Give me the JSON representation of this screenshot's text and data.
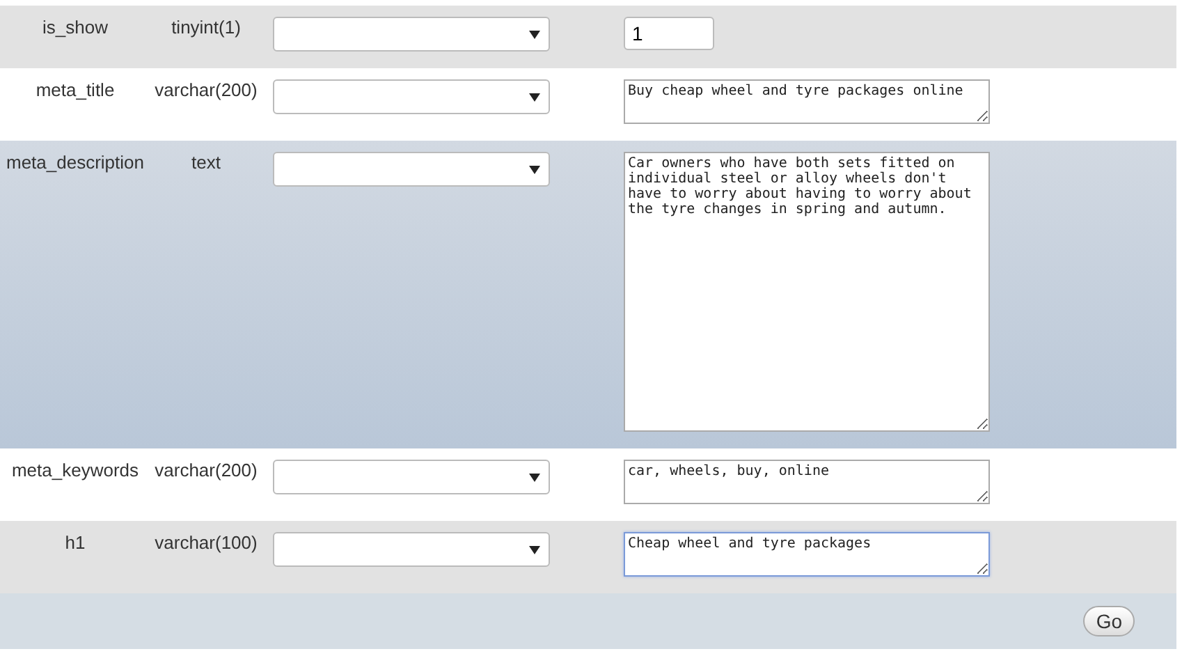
{
  "rows": [
    {
      "name": "is_show",
      "type": "tinyint(1)",
      "kind": "input",
      "value": "1",
      "highlighted": false,
      "focused": false
    },
    {
      "name": "meta_title",
      "type": "varchar(200)",
      "kind": "textarea",
      "value": "Buy cheap wheel and tyre packages online",
      "highlighted": false,
      "focused": false
    },
    {
      "name": "meta_description",
      "type": "text",
      "kind": "textarea-large",
      "value": "Car owners who have both sets fitted on individual steel or alloy wheels don't have to worry about having to worry about the tyre changes in spring and autumn.",
      "highlighted": true,
      "focused": false
    },
    {
      "name": "meta_keywords",
      "type": "varchar(200)",
      "kind": "textarea",
      "value": "car, wheels, buy, online",
      "highlighted": false,
      "focused": false
    },
    {
      "name": "h1",
      "type": "varchar(100)",
      "kind": "textarea",
      "value": "Cheap wheel and tyre packages",
      "highlighted": false,
      "focused": true
    }
  ],
  "footer": {
    "button": "Go"
  }
}
